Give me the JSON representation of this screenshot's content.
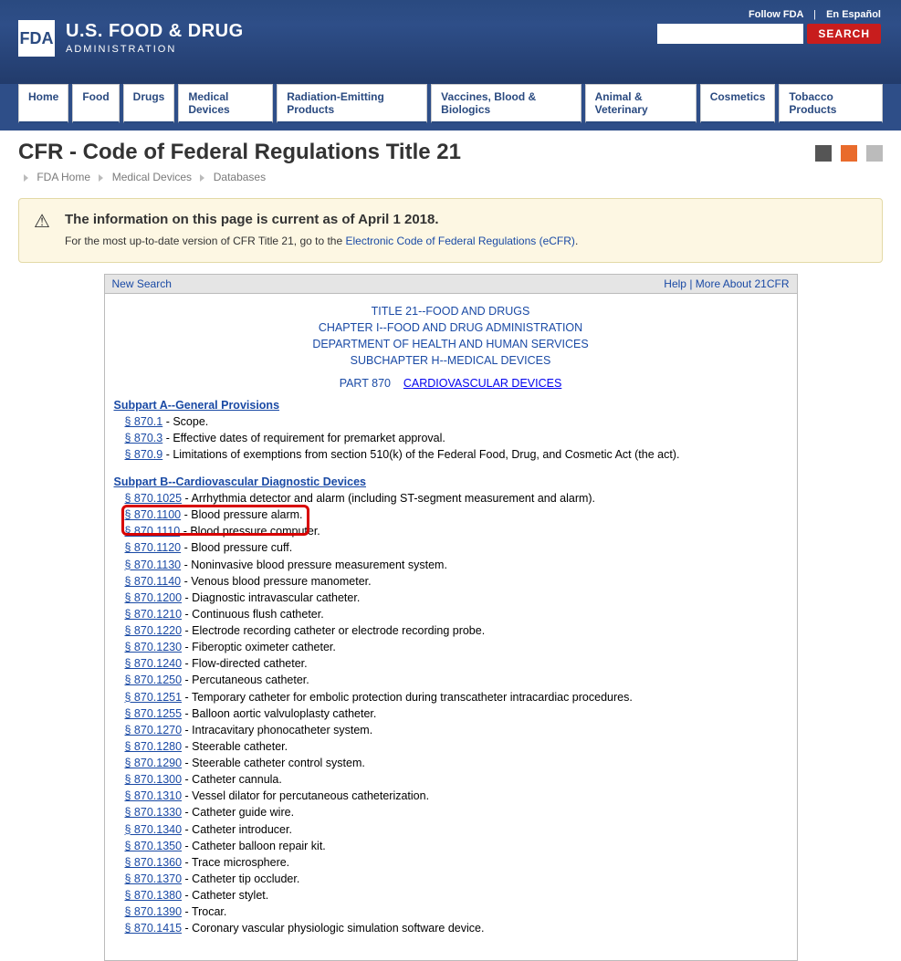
{
  "header": {
    "logo_short": "FDA",
    "logo_main": "U.S. FOOD & DRUG",
    "logo_sub": "ADMINISTRATION",
    "follow": "Follow FDA",
    "espanol": "En Español",
    "search_btn": "SEARCH"
  },
  "nav": [
    "Home",
    "Food",
    "Drugs",
    "Medical Devices",
    "Radiation-Emitting Products",
    "Vaccines, Blood & Biologics",
    "Animal & Veterinary",
    "Cosmetics",
    "Tobacco Products"
  ],
  "page_title": "CFR - Code of Federal Regulations Title 21",
  "breadcrumb": [
    "FDA Home",
    "Medical Devices",
    "Databases"
  ],
  "notice": {
    "title": "The information on this page is current as of April 1 2018.",
    "body_pre": "For the most up-to-date version of CFR Title 21, go to the ",
    "body_link": "Electronic Code of Federal Regulations (eCFR)",
    "body_post": "."
  },
  "frame_head": {
    "new_search": "New Search",
    "help": "Help",
    "more": "More About 21CFR"
  },
  "doc_header": {
    "l1": "TITLE 21--FOOD AND DRUGS",
    "l2": "CHAPTER I--FOOD AND DRUG ADMINISTRATION",
    "l3": "DEPARTMENT OF HEALTH AND HUMAN SERVICES",
    "l4": "SUBCHAPTER H--MEDICAL DEVICES",
    "part_label": "PART 870",
    "part_link": "CARDIOVASCULAR DEVICES"
  },
  "subparts": [
    {
      "title": "Subpart A--General Provisions",
      "items": [
        {
          "sec": "§ 870.1",
          "desc": "Scope."
        },
        {
          "sec": "§ 870.3",
          "desc": "Effective dates of requirement for premarket approval."
        },
        {
          "sec": "§ 870.9",
          "desc": "Limitations of exemptions from section 510(k) of the Federal Food, Drug, and Cosmetic Act (the act)."
        }
      ]
    },
    {
      "title": "Subpart B--Cardiovascular Diagnostic Devices",
      "highlight_index": 1,
      "items": [
        {
          "sec": "§ 870.1025",
          "desc": "Arrhythmia detector and alarm (including ST-segment measurement and alarm)."
        },
        {
          "sec": "§ 870.1100",
          "desc": "Blood pressure alarm."
        },
        {
          "sec": "§ 870.1110",
          "desc": "Blood pressure computer."
        },
        {
          "sec": "§ 870.1120",
          "desc": "Blood pressure cuff."
        },
        {
          "sec": "§ 870.1130",
          "desc": "Noninvasive blood pressure measurement system."
        },
        {
          "sec": "§ 870.1140",
          "desc": "Venous blood pressure manometer."
        },
        {
          "sec": "§ 870.1200",
          "desc": "Diagnostic intravascular catheter."
        },
        {
          "sec": "§ 870.1210",
          "desc": "Continuous flush catheter."
        },
        {
          "sec": "§ 870.1220",
          "desc": "Electrode recording catheter or electrode recording probe."
        },
        {
          "sec": "§ 870.1230",
          "desc": "Fiberoptic oximeter catheter."
        },
        {
          "sec": "§ 870.1240",
          "desc": "Flow-directed catheter."
        },
        {
          "sec": "§ 870.1250",
          "desc": "Percutaneous catheter."
        },
        {
          "sec": "§ 870.1251",
          "desc": "Temporary catheter for embolic protection during transcatheter intracardiac procedures."
        },
        {
          "sec": "§ 870.1255",
          "desc": "Balloon aortic valvuloplasty catheter."
        },
        {
          "sec": "§ 870.1270",
          "desc": "Intracavitary phonocatheter system."
        },
        {
          "sec": "§ 870.1280",
          "desc": "Steerable catheter."
        },
        {
          "sec": "§ 870.1290",
          "desc": "Steerable catheter control system."
        },
        {
          "sec": "§ 870.1300",
          "desc": "Catheter cannula."
        },
        {
          "sec": "§ 870.1310",
          "desc": "Vessel dilator for percutaneous catheterization."
        },
        {
          "sec": "§ 870.1330",
          "desc": "Catheter guide wire."
        },
        {
          "sec": "§ 870.1340",
          "desc": "Catheter introducer."
        },
        {
          "sec": "§ 870.1350",
          "desc": "Catheter balloon repair kit."
        },
        {
          "sec": "§ 870.1360",
          "desc": "Trace microsphere."
        },
        {
          "sec": "§ 870.1370",
          "desc": "Catheter tip occluder."
        },
        {
          "sec": "§ 870.1380",
          "desc": "Catheter stylet."
        },
        {
          "sec": "§ 870.1390",
          "desc": "Trocar."
        },
        {
          "sec": "§ 870.1415",
          "desc": "Coronary vascular physiologic simulation software device."
        }
      ]
    }
  ]
}
